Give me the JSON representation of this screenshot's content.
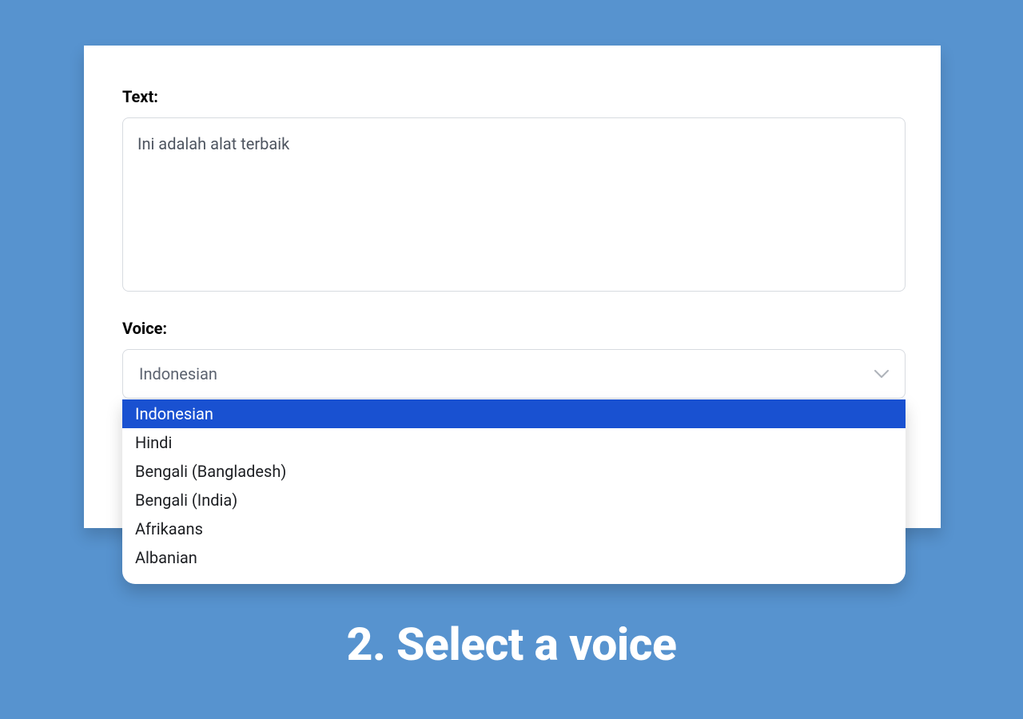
{
  "form": {
    "text_label": "Text:",
    "text_value": "Ini adalah alat terbaik",
    "voice_label": "Voice:",
    "voice_selected": "Indonesian",
    "voice_options": [
      "Indonesian",
      "Hindi",
      "Bengali (Bangladesh)",
      "Bengali (India)",
      "Afrikaans",
      "Albanian"
    ]
  },
  "caption": "2. Select a voice"
}
